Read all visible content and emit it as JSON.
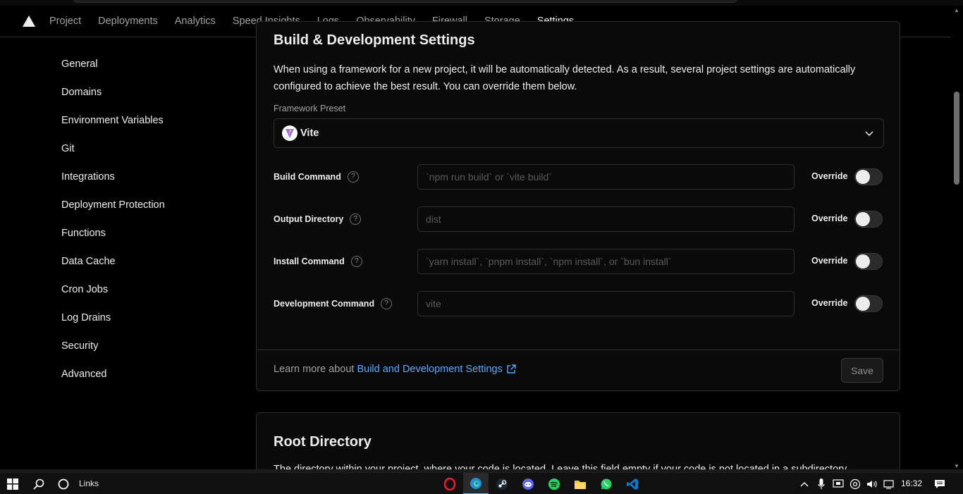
{
  "nav": {
    "tabs": [
      {
        "label": "Project"
      },
      {
        "label": "Deployments"
      },
      {
        "label": "Analytics"
      },
      {
        "label": "Speed Insights"
      },
      {
        "label": "Logs"
      },
      {
        "label": "Observability"
      },
      {
        "label": "Firewall"
      },
      {
        "label": "Storage"
      },
      {
        "label": "Settings",
        "active": true
      }
    ]
  },
  "sidebar": {
    "items": [
      {
        "label": "General"
      },
      {
        "label": "Domains"
      },
      {
        "label": "Environment Variables"
      },
      {
        "label": "Git"
      },
      {
        "label": "Integrations"
      },
      {
        "label": "Deployment Protection"
      },
      {
        "label": "Functions"
      },
      {
        "label": "Data Cache"
      },
      {
        "label": "Cron Jobs"
      },
      {
        "label": "Log Drains"
      },
      {
        "label": "Security"
      },
      {
        "label": "Advanced"
      }
    ]
  },
  "build_settings": {
    "title": "Build & Development Settings",
    "description": "When using a framework for a new project, it will be automatically detected. As a result, several project settings are automatically configured to achieve the best result. You can override them below.",
    "framework_label": "Framework Preset",
    "framework_value": "Vite",
    "override_label": "Override",
    "rows": [
      {
        "label": "Build Command",
        "placeholder": "`npm run build` or `vite build`",
        "override": false
      },
      {
        "label": "Output Directory",
        "placeholder": "dist",
        "override": false
      },
      {
        "label": "Install Command",
        "placeholder": "`yarn install`, `pnpm install`, `npm install`, or `bun install`",
        "override": false
      },
      {
        "label": "Development Command",
        "placeholder": "vite",
        "override": false
      }
    ],
    "help_glyph": "?",
    "footer_prefix": "Learn more about",
    "footer_link": "Build and Development Settings",
    "save_label": "Save"
  },
  "root_directory": {
    "title": "Root Directory",
    "description": "The directory within your project, where your code is located. Leave this field empty if your code is not located in a subdirectory."
  },
  "taskbar": {
    "search_label": "Links",
    "time": "16:32",
    "apps": [
      "opera-icon",
      "edge-icon",
      "steam-icon",
      "discord-icon",
      "spotify-icon",
      "file-explorer-icon",
      "whatsapp-icon",
      "vscode-icon"
    ],
    "active_app": "edge-icon"
  },
  "colors": {
    "background": "#000000",
    "card": "#0a0a0a",
    "border": "#2e2e2e",
    "link": "#52a8ff",
    "text": "#ededed",
    "muted": "#a1a1a1"
  }
}
